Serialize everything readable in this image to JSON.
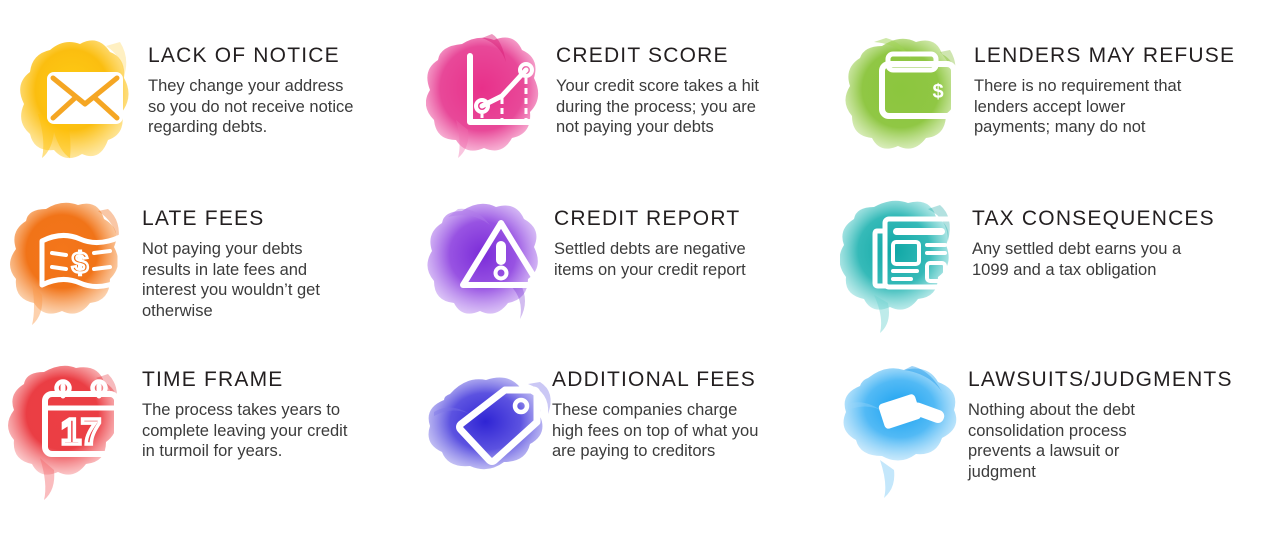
{
  "page": {
    "background": "#ffffff",
    "title_color": "#231f20",
    "body_color": "#3b3b3b"
  },
  "cells": [
    {
      "title": "LACK OF NOTICE",
      "body": "They change your address\nso you do not receive notice\nregarding debts.",
      "icon": "envelope-icon",
      "color": "#f7b500",
      "color_dark": "#f0a000",
      "color_light": "#ffd766"
    },
    {
      "title": "CREDIT SCORE",
      "body": "Your credit score takes a hit\nduring the process; you are\nnot paying your debts",
      "icon": "line-chart-icon",
      "color": "#e8308a",
      "color_dark": "#d81b74",
      "color_light": "#f77fb8"
    },
    {
      "title": "LENDERS MAY REFUSE",
      "body": "There is no requirement that\nlenders accept lower\npayments; many do not",
      "icon": "wallet-icon",
      "color": "#8cc63e",
      "color_dark": "#76b51e",
      "color_light": "#c3e28c"
    },
    {
      "title": "LATE FEES",
      "body": "Not paying your debts\nresults in late fees and\ninterest you wouldn’t get\notherwise",
      "icon": "banknote-icon",
      "color": "#f4761b",
      "color_dark": "#ee5f00",
      "color_light": "#fbb173"
    },
    {
      "title": "CREDIT REPORT",
      "body": "Settled debts are negative\nitems on your credit report",
      "icon": "warning-triangle-icon",
      "color": "#8b3fe0",
      "color_dark": "#6a21cc",
      "color_light": "#c39bf2"
    },
    {
      "title": "TAX CONSEQUENCES",
      "body": "Any settled debt earns you a\n1099 and a tax obligation",
      "icon": "newspaper-icon",
      "color": "#18b0ae",
      "color_dark": "#039a99",
      "color_light": "#8adedd"
    },
    {
      "title": "TIME FRAME",
      "body": "The process takes years to\ncomplete leaving your credit\nin turmoil for years.",
      "icon": "calendar-icon",
      "calendar_day": "17",
      "color": "#ec3f45",
      "color_dark": "#e01c24",
      "color_light": "#f79295"
    },
    {
      "title": "ADDITIONAL FEES",
      "body": "These companies charge\nhigh fees on top of what you\nare paying to creditors",
      "icon": "price-tag-icon",
      "color": "#3b32d8",
      "color_dark": "#2a20cf",
      "color_light": "#9b96ea"
    },
    {
      "title": "LAWSUITS/JUDGMENTS",
      "body": "Nothing about the debt\nconsolidation process\nprevents a lawsuit or\njudgment",
      "icon": "gavel-icon",
      "color": "#29a9f2",
      "color_dark": "#0d90e8",
      "color_light": "#93d3f8"
    }
  ]
}
